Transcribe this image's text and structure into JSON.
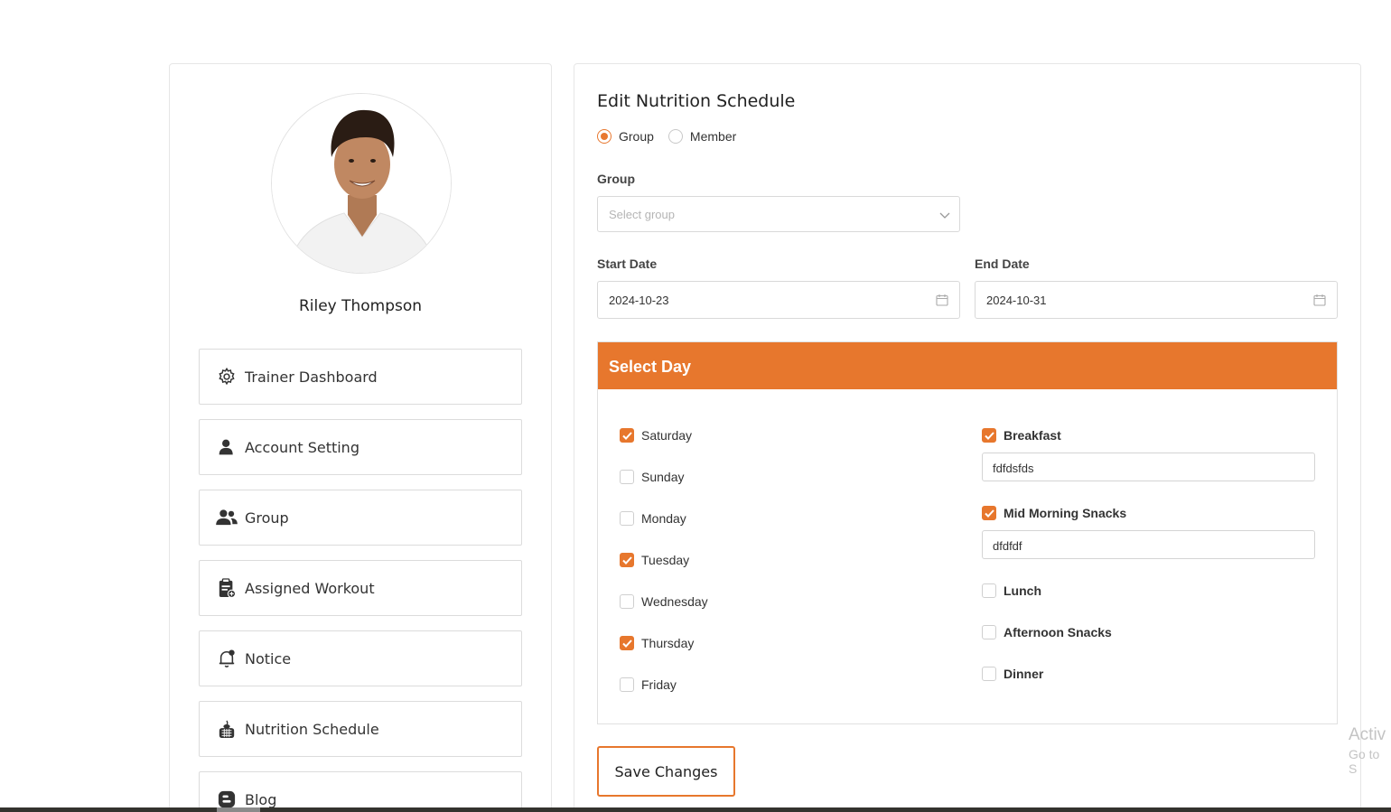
{
  "profile": {
    "name": "Riley Thompson"
  },
  "menu": [
    {
      "label": "Trainer Dashboard",
      "icon": "gear-icon"
    },
    {
      "label": "Account Setting",
      "icon": "user-icon"
    },
    {
      "label": "Group",
      "icon": "users-icon"
    },
    {
      "label": "Assigned Workout",
      "icon": "clipboard-icon"
    },
    {
      "label": "Notice",
      "icon": "bell-icon"
    },
    {
      "label": "Nutrition Schedule",
      "icon": "food-icon"
    },
    {
      "label": "Blog",
      "icon": "blog-icon"
    }
  ],
  "form": {
    "title": "Edit Nutrition Schedule",
    "target_options": [
      {
        "label": "Group",
        "selected": true
      },
      {
        "label": "Member",
        "selected": false
      }
    ],
    "group_label": "Group",
    "group_placeholder": "Select group",
    "start_label": "Start Date",
    "start_value": "2024-10-23",
    "end_label": "End Date",
    "end_value": "2024-10-31",
    "day_panel_title": "Select Day",
    "days": [
      {
        "label": "Saturday",
        "checked": true
      },
      {
        "label": "Sunday",
        "checked": false
      },
      {
        "label": "Monday",
        "checked": false
      },
      {
        "label": "Tuesday",
        "checked": true
      },
      {
        "label": "Wednesday",
        "checked": false
      },
      {
        "label": "Thursday",
        "checked": true
      },
      {
        "label": "Friday",
        "checked": false
      }
    ],
    "meals": [
      {
        "label": "Breakfast",
        "checked": true,
        "value": "fdfdsfds"
      },
      {
        "label": "Mid Morning Snacks",
        "checked": true,
        "value": "dfdfdf"
      },
      {
        "label": "Lunch",
        "checked": false
      },
      {
        "label": "Afternoon Snacks",
        "checked": false
      },
      {
        "label": "Dinner",
        "checked": false
      }
    ],
    "save_label": "Save Changes"
  },
  "watermark": {
    "line1": "Activ",
    "line2": "Go to S"
  },
  "colors": {
    "accent": "#e7772d",
    "border": "#dcdcdc"
  }
}
